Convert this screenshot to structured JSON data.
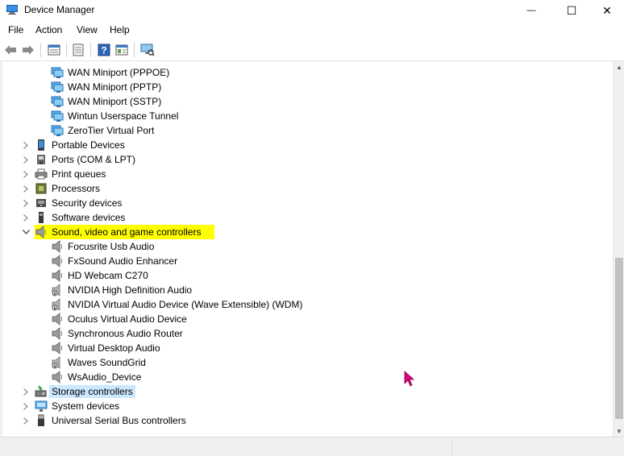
{
  "window": {
    "title": "Device Manager",
    "minimize_glyph": "—",
    "maximize_glyph": "☐",
    "close_glyph": "✕"
  },
  "menu": [
    "File",
    "Action",
    "View",
    "Help"
  ],
  "toolbar": {
    "buttons": [
      "back-icon",
      "forward-icon",
      "properties-icon",
      "update-driver-icon",
      "help-icon",
      "show-hidden-icon",
      "scan-hardware-icon"
    ]
  },
  "tree": {
    "rows": [
      {
        "label": "WAN Miniport (PPPOE)",
        "level": 2,
        "icon": "network-adapter-icon"
      },
      {
        "label": "WAN Miniport (PPTP)",
        "level": 2,
        "icon": "network-adapter-icon"
      },
      {
        "label": "WAN Miniport (SSTP)",
        "level": 2,
        "icon": "network-adapter-icon"
      },
      {
        "label": "Wintun Userspace Tunnel",
        "level": 2,
        "icon": "network-adapter-icon"
      },
      {
        "label": "ZeroTier Virtual Port",
        "level": 2,
        "icon": "network-adapter-icon"
      },
      {
        "label": "Portable Devices",
        "level": 1,
        "icon": "portable-device-icon",
        "expander": "collapsed"
      },
      {
        "label": "Ports (COM & LPT)",
        "level": 1,
        "icon": "port-icon",
        "expander": "collapsed"
      },
      {
        "label": "Print queues",
        "level": 1,
        "icon": "printer-icon",
        "expander": "collapsed"
      },
      {
        "label": "Processors",
        "level": 1,
        "icon": "processor-icon",
        "expander": "collapsed"
      },
      {
        "label": "Security devices",
        "level": 1,
        "icon": "security-device-icon",
        "expander": "collapsed"
      },
      {
        "label": "Software devices",
        "level": 1,
        "icon": "software-device-icon",
        "expander": "collapsed"
      },
      {
        "label": "Sound, video and game controllers",
        "level": 1,
        "icon": "speaker-icon",
        "expander": "expanded",
        "state": "highlighted"
      },
      {
        "label": "Focusrite Usb Audio",
        "level": 2,
        "icon": "speaker-icon"
      },
      {
        "label": "FxSound Audio Enhancer",
        "level": 2,
        "icon": "speaker-icon"
      },
      {
        "label": "HD Webcam C270",
        "level": 2,
        "icon": "speaker-icon"
      },
      {
        "label": "NVIDIA High Definition Audio",
        "level": 2,
        "icon": "speaker-disabled-icon"
      },
      {
        "label": "NVIDIA Virtual Audio Device (Wave Extensible) (WDM)",
        "level": 2,
        "icon": "speaker-disabled-icon"
      },
      {
        "label": "Oculus Virtual Audio Device",
        "level": 2,
        "icon": "speaker-icon"
      },
      {
        "label": "Synchronous Audio Router",
        "level": 2,
        "icon": "speaker-icon"
      },
      {
        "label": "Virtual Desktop Audio",
        "level": 2,
        "icon": "speaker-icon"
      },
      {
        "label": "Waves SoundGrid",
        "level": 2,
        "icon": "speaker-disabled-icon"
      },
      {
        "label": "WsAudio_Device",
        "level": 2,
        "icon": "speaker-icon"
      },
      {
        "label": "Storage controllers",
        "level": 1,
        "icon": "storage-controller-icon",
        "expander": "collapsed",
        "state": "selected"
      },
      {
        "label": "System devices",
        "level": 1,
        "icon": "system-device-icon",
        "expander": "collapsed"
      },
      {
        "label": "Universal Serial Bus controllers",
        "level": 1,
        "icon": "usb-icon",
        "expander": "collapsed"
      }
    ]
  },
  "colors": {
    "highlight": "#ffff00",
    "selected": "#cce8ff",
    "cursor": "#e0007a"
  }
}
